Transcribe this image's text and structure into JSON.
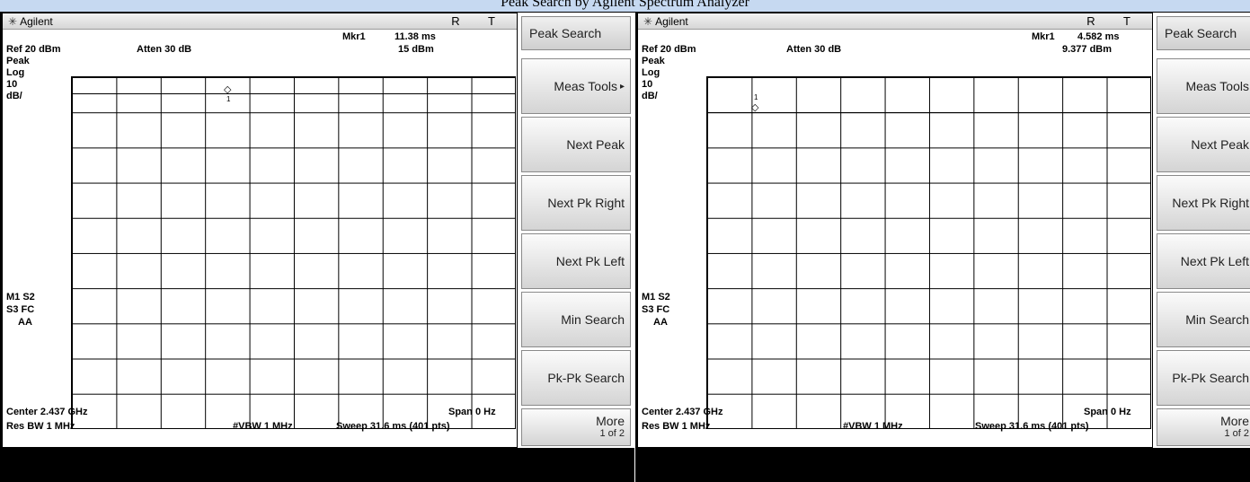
{
  "caption": "Peak Search by Agilent Spectrum Analyzer",
  "panels": [
    {
      "brand": "Agilent",
      "indicators": "R T",
      "marker_readout": {
        "label": "Mkr1",
        "time": "11.38 ms",
        "level": "15 dBm"
      },
      "ref": "Ref 20 dBm",
      "atten": "Atten 30 dB",
      "scale": [
        "Peak",
        "Log",
        "10",
        "dB/"
      ],
      "side_labels": {
        "m1s2": "M1 S2",
        "s3fc": "S3 FC",
        "aa": "AA"
      },
      "center": "Center 2.437 GHz",
      "span": "Span 0 Hz",
      "res_bw": "Res BW 1 MHz",
      "vbw": "#VBW 1 MHz",
      "sweep": "Sweep 31.6 ms (401 pts)",
      "marker_number": "1",
      "softkeys": {
        "title": "Peak Search",
        "items": [
          "Meas Tools",
          "Next Peak",
          "Next Pk Right",
          "Next Pk Left",
          "Min Search",
          "Pk-Pk Search"
        ],
        "submenu_arrow": "▸",
        "more": "More",
        "more_sub": "1 of 2"
      }
    },
    {
      "brand": "Agilent",
      "indicators": "R T",
      "marker_readout": {
        "label": "Mkr1",
        "time": "4.582 ms",
        "level": "9.377 dBm"
      },
      "ref": "Ref 20 dBm",
      "atten": "Atten 30 dB",
      "scale": [
        "Peak",
        "Log",
        "10",
        "dB/"
      ],
      "side_labels": {
        "m1s2": "M1 S2",
        "s3fc": "S3 FC",
        "aa": "AA"
      },
      "center": "Center 2.437 GHz",
      "span": "Span 0 Hz",
      "res_bw": "Res BW 1 MHz",
      "vbw": "#VBW 1 MHz",
      "sweep": "Sweep 31.6 ms (401 pts)",
      "marker_number": "1",
      "softkeys": {
        "title": "Peak Search",
        "items": [
          "Meas Tools",
          "Next Peak",
          "Next Pk Right",
          "Next Pk Left",
          "Min Search",
          "Pk-Pk Search"
        ],
        "more": "More",
        "more_sub": "1 of 2"
      }
    }
  ]
}
